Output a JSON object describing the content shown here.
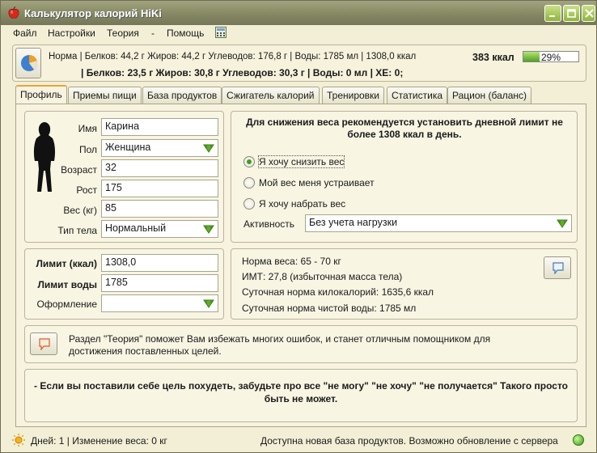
{
  "window": {
    "title": "Калькулятор калорий HiKi"
  },
  "menu": {
    "items": [
      "Файл",
      "Настройки",
      "Теория",
      "-",
      "Помощь"
    ],
    "icon": "calculator-icon"
  },
  "summary": {
    "line1": "Норма | Белков: 44,2 г Жиров: 44,2 г Углеводов: 176,8 г | Воды: 1785 мл | 1308,0 ккал",
    "line2": "| Белков: 23,5 г Жиров: 30,8 г Углеводов: 30,3 г | Воды: 0 мл | ХЕ: 0;",
    "kcal": "383 ккал",
    "percent_text": "29%",
    "percent_value": 29,
    "progress_color": "#4fa21e"
  },
  "tabs": [
    "Профиль",
    "Приемы пищи",
    "База продуктов",
    "Сжигатель калорий",
    "Тренировки",
    "Статистика",
    "Рацион (баланс)"
  ],
  "profile": {
    "name_label": "Имя",
    "name_value": "Карина",
    "sex_label": "Пол",
    "sex_value": "Женщина",
    "age_label": "Возраст",
    "age_value": "32",
    "height_label": "Рост",
    "height_value": "175",
    "weight_label": "Вес (кг)",
    "weight_value": "85",
    "body_label": "Тип тела",
    "body_value": "Нормальный"
  },
  "goal": {
    "recommendation": "Для снижения веса рекомендуется установить дневной лимит не более 1308 ккал в день.",
    "options": [
      "Я хочу снизить вес",
      "Мой вес меня устраивает",
      "Я хочу набрать вес"
    ],
    "selected_index": 0,
    "activity_label": "Активность",
    "activity_value": "Без учета нагрузки"
  },
  "limits": {
    "kcal_label": "Лимит (ккал)",
    "kcal_value": "1308,0",
    "water_label": "Лимит воды",
    "water_value": "1785",
    "style_label": "Оформление",
    "style_value": ""
  },
  "stats": {
    "norm_weight": "Норма веса: 65 - 70 кг",
    "bmi": "ИМТ: 27,8 (избыточная масса тела)",
    "kcal_norm": "Суточная норма килокалорий: 1635,6 ккал",
    "water_norm": "Суточная норма чистой воды: 1785 мл"
  },
  "theory_hint": "Раздел \"Теория\" поможет Вам избежать многих ошибок, и станет отличным помощником для достижения поставленных целей.",
  "motivation": "- Если вы поставили себе цель похудеть, забудьте про все \"не могу\" \"не хочу\" \"не получается\" Такого просто быть не может.",
  "status": {
    "days": "Дней: 1 | Изменение веса: 0 кг",
    "update": "Доступна новая база продуктов. Возможно обновление с сервера"
  }
}
